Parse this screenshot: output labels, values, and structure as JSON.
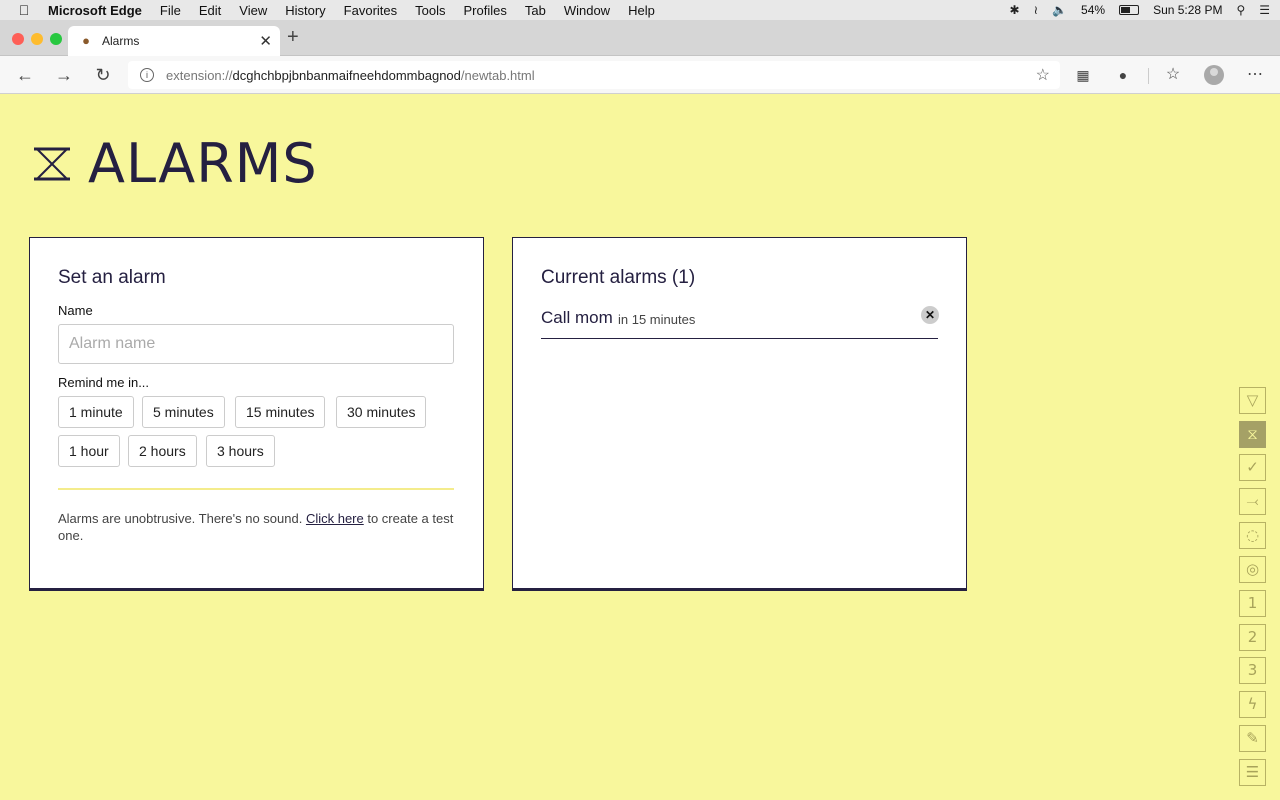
{
  "menubar": {
    "app_name": "Microsoft Edge",
    "items": [
      "File",
      "Edit",
      "View",
      "History",
      "Favorites",
      "Tools",
      "Profiles",
      "Tab",
      "Window",
      "Help"
    ],
    "battery": "54%",
    "clock": "Sun 5:28 PM"
  },
  "browser": {
    "tab_title": "Alarms",
    "url_scheme": "extension://",
    "url_host": "dcghchbpjbnbanmaifneehdommbagnod",
    "url_path": "/newtab.html"
  },
  "page": {
    "title": "ALARMS",
    "set_alarm": {
      "heading": "Set an alarm",
      "name_label": "Name",
      "name_placeholder": "Alarm name",
      "name_value": "",
      "remind_label": "Remind me in...",
      "durations": [
        "1 minute",
        "5 minutes",
        "15 minutes",
        "30 minutes",
        "1 hour",
        "2 hours",
        "3 hours"
      ],
      "note_before": "Alarms are unobtrusive. There's no sound. ",
      "note_link": "Click here",
      "note_after": " to create a test one."
    },
    "current_alarms": {
      "heading": "Current alarms (1)",
      "alarms": [
        {
          "name": "Call mom",
          "when": "in 15 minutes"
        }
      ]
    }
  },
  "rail": {
    "items": [
      "▽",
      "⧖",
      "✓",
      "⤙",
      "◌",
      "◎",
      "1",
      "2",
      "3",
      "ϟ",
      "✎",
      "☰"
    ],
    "active_index": 1
  },
  "colors": {
    "background": "#f8f79c",
    "accent": "#252041",
    "rail": "#a8a35a"
  }
}
